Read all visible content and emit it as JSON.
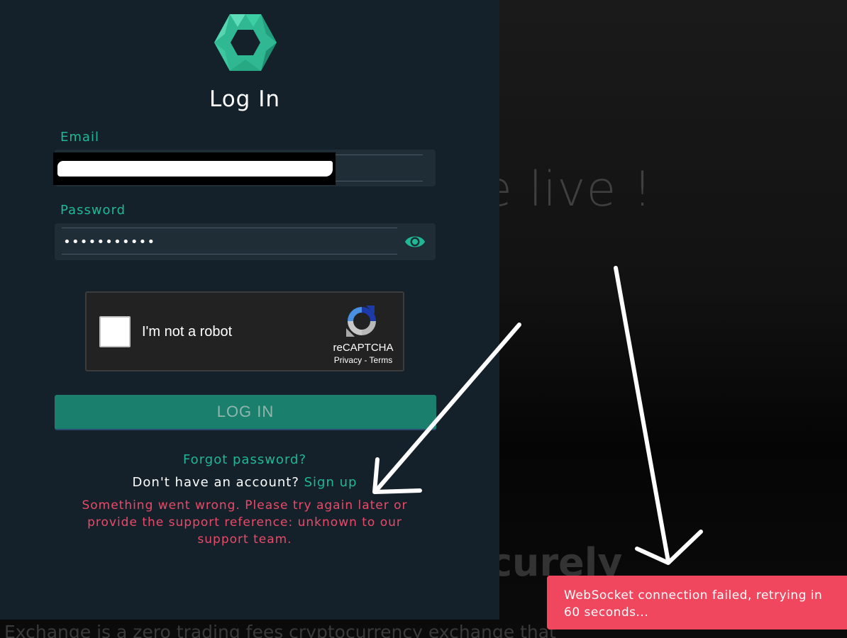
{
  "background": {
    "headline": "e live !",
    "subheadline": "curely",
    "description": "Exchange is a zero trading fees cryptocurrency exchange that"
  },
  "login": {
    "title": "Log In",
    "email_label": "Email",
    "email_value": "",
    "password_label": "Password",
    "password_value": "•••••••••••",
    "password_toggle_icon": "eye-icon",
    "captcha": {
      "label": "I'm not a robot",
      "brand": "reCAPTCHA",
      "links": "Privacy - Terms"
    },
    "submit_label": "LOG IN",
    "forgot_password": "Forgot password?",
    "no_account_text": "Don't have an account?",
    "signup_link": "Sign up",
    "error_message": "Something went wrong. Please try again later or provide the support reference: unknown to our support team."
  },
  "toast": {
    "message": "WebSocket connection failed, retrying in 60 seconds..."
  },
  "colors": {
    "accent": "#1fb894",
    "panel_bg": "#15212a",
    "error": "#ea4a68",
    "toast_bg": "#f0475f",
    "button_bg": "#1a7f6c"
  }
}
